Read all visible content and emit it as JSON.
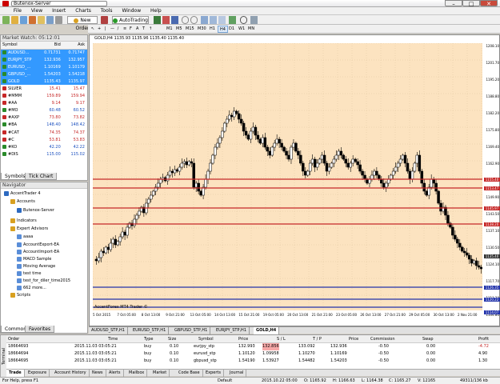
{
  "window": {
    "title": "Butenox-Server",
    "min": "–",
    "max": "□",
    "close": "✕"
  },
  "menu": [
    "File",
    "View",
    "Insert",
    "Charts",
    "Tools",
    "Window",
    "Help"
  ],
  "toolbar": {
    "new_order": "New Order",
    "autotrading": "AutoTrading"
  },
  "timeframes": [
    "M1",
    "M5",
    "M15",
    "M30",
    "H1",
    "H4",
    "D1",
    "W1",
    "MN"
  ],
  "timeframe_selected": "H4",
  "market_watch": {
    "title": "Market Watch: 05:12:01",
    "columns": [
      "Symbol",
      "Bid",
      "Ask"
    ],
    "rows": [
      {
        "symbol": "AUDUSD...",
        "bid": "0.71731",
        "ask": "0.71747",
        "dir": "up",
        "sel": true
      },
      {
        "symbol": "EURJPY_STP",
        "bid": "132.936",
        "ask": "132.957",
        "dir": "up",
        "sel": true
      },
      {
        "symbol": "EURUSD_...",
        "bid": "1.10169",
        "ask": "1.10179",
        "dir": "up",
        "sel": true
      },
      {
        "symbol": "GBPUSD_...",
        "bid": "1.54203",
        "ask": "1.54218",
        "dir": "up",
        "sel": true
      },
      {
        "symbol": "GOLD",
        "bid": "1135.43",
        "ask": "1135.97",
        "dir": "up",
        "sel": true
      },
      {
        "symbol": "SILVER",
        "bid": "15.41",
        "ask": "15.47",
        "dir": "dn",
        "sel": false
      },
      {
        "symbol": "#MMM",
        "bid": "159.89",
        "ask": "159.94",
        "dir": "dn",
        "sel": false
      },
      {
        "symbol": "#AA",
        "bid": "9.14",
        "ask": "9.17",
        "dir": "dn",
        "sel": false
      },
      {
        "symbol": "#MO",
        "bid": "60.48",
        "ask": "60.52",
        "dir": "up",
        "sel": false
      },
      {
        "symbol": "#AXP",
        "bid": "73.80",
        "ask": "73.82",
        "dir": "dn",
        "sel": false
      },
      {
        "symbol": "#BA",
        "bid": "148.40",
        "ask": "148.42",
        "dir": "up",
        "sel": false
      },
      {
        "symbol": "#CAT",
        "bid": "74.35",
        "ask": "74.37",
        "dir": "dn",
        "sel": false
      },
      {
        "symbol": "#C",
        "bid": "53.81",
        "ask": "53.83",
        "dir": "dn",
        "sel": false
      },
      {
        "symbol": "#KO",
        "bid": "42.20",
        "ask": "42.22",
        "dir": "up",
        "sel": false
      },
      {
        "symbol": "#DIS",
        "bid": "115.00",
        "ask": "115.02",
        "dir": "up",
        "sel": false
      }
    ],
    "tabs": [
      "Symbols",
      "Tick Chart"
    ]
  },
  "navigator": {
    "title": "Navigator",
    "items": [
      {
        "label": "AccentTrader 4",
        "indent": 0,
        "color": "#2d6ac0"
      },
      {
        "label": "Accounts",
        "indent": 1,
        "color": "#d8a020"
      },
      {
        "label": "Butenox-Server",
        "indent": 2,
        "color": "#2d6ac0"
      },
      {
        "label": "Indicators",
        "indent": 1,
        "color": "#d8a020"
      },
      {
        "label": "Expert Advisors",
        "indent": 1,
        "color": "#d8a020"
      },
      {
        "label": "aaaa",
        "indent": 2,
        "color": "#5a8ed8"
      },
      {
        "label": "AccountExport-EA",
        "indent": 2,
        "color": "#5a8ed8"
      },
      {
        "label": "AccountImport-EA",
        "indent": 2,
        "color": "#5a8ed8"
      },
      {
        "label": "MACD Sample",
        "indent": 2,
        "color": "#5a8ed8"
      },
      {
        "label": "Moving Average",
        "indent": 2,
        "color": "#5a8ed8"
      },
      {
        "label": "test time",
        "indent": 2,
        "color": "#5a8ed8"
      },
      {
        "label": "test_for_diler_time2015",
        "indent": 2,
        "color": "#5a8ed8"
      },
      {
        "label": "662 more...",
        "indent": 2,
        "color": "#5a8ed8"
      },
      {
        "label": "Scripts",
        "indent": 1,
        "color": "#d8a020"
      }
    ],
    "tabs": [
      "Common",
      "Favorites"
    ]
  },
  "chart": {
    "header": "GOLD,H4  1135.93 1135.96 1135.40 1135.40",
    "watermark": "AccentForex MT4 Trader ©",
    "y_labels": [
      "1208.10",
      "1201.70",
      "1195.20",
      "1188.80",
      "1182.20",
      "1175.80",
      "1169.40",
      "1162.90",
      "1156.50",
      "1149.90",
      "1143.50",
      "1137.10",
      "1130.50",
      "1124.10",
      "1117.70",
      "1111.20",
      "1104.80"
    ],
    "tags": [
      {
        "text": "1155.40",
        "color": "#c62828"
      },
      {
        "text": "1153.47",
        "color": "#c62828"
      },
      {
        "text": "1145.97",
        "color": "#c62828"
      },
      {
        "text": "1138.20",
        "color": "#c62828"
      },
      {
        "text": "1135.40",
        "color": "#333333"
      },
      {
        "text": "1126.35",
        "color": "#2233aa"
      },
      {
        "text": "1120.22",
        "color": "#2233aa"
      },
      {
        "text": "1114.07",
        "color": "#2233aa"
      }
    ],
    "x_labels": [
      "5 Oct 2015",
      "7 Oct 05:00",
      "8 Oct 13:00",
      "9 Oct 21:00",
      "13 Oct 05:00",
      "14 Oct 13:00",
      "15 Oct 21:00",
      "19 Oct 05:00",
      "20 Oct 13:00",
      "21 Oct 21:00",
      "23 Oct 05:00",
      "26 Oct 13:00",
      "27 Oct 21:00",
      "29 Oct 05:00",
      "30 Oct 13:00",
      "2 Nov 21:00"
    ]
  },
  "chart_tabs": [
    "AUDUSD_STP,H1",
    "EURUSD_STP,H1",
    "GBPUSD_STP,H1",
    "EURJPY_STP,H1",
    "GOLD,H4"
  ],
  "terminal": {
    "columns": [
      "Order",
      "Time",
      "Type",
      "Size",
      "Symbol",
      "Price",
      "S / L",
      "T / P",
      "Price",
      "Commission",
      "Swap",
      "Profit"
    ],
    "rows": [
      [
        "18664693",
        "2015.11.03 03:05:21",
        "buy",
        "0.10",
        "eurjpy_stp",
        "132.993",
        "132.856",
        "133.092",
        "132.936",
        "-0.50",
        "0.00",
        "-4.72"
      ],
      [
        "18664694",
        "2015.11.03 03:05:21",
        "buy",
        "0.10",
        "eurusd_stp",
        "1.10120",
        "1.09958",
        "1.10270",
        "1.10169",
        "-0.50",
        "0.00",
        "4.90"
      ],
      [
        "18664695",
        "2015.11.03 03:05:21",
        "buy",
        "0.10",
        "gbpusd_stp",
        "1.54190",
        "1.53927",
        "1.54482",
        "1.54203",
        "-0.50",
        "0.00",
        "1.30"
      ]
    ],
    "side_label": "Terminal",
    "tabs": [
      "Trade",
      "Exposure",
      "Account History",
      "News",
      "Alerts",
      "Mailbox",
      "Market",
      "Code Base",
      "Experts",
      "Journal"
    ]
  },
  "status": {
    "help": "For Help, press F1",
    "profile": "Default",
    "datetime": "2015.10.22 05:00",
    "open": "O: 1165.92",
    "high": "H: 1166.63",
    "low": "L: 1164.38",
    "close": "C: 1165.27",
    "volume": "V: 12165",
    "traffic": "49311/136 kb"
  }
}
